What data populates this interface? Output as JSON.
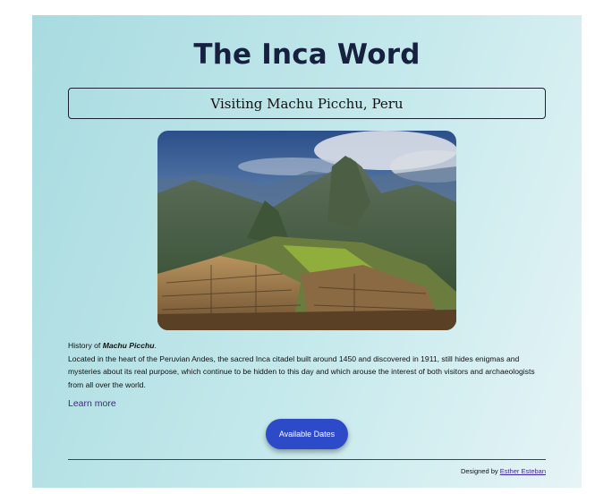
{
  "header": {
    "title": "The Inca Word"
  },
  "section": {
    "heading": "Visiting Machu Picchu, Peru"
  },
  "article": {
    "history_prefix": "History of ",
    "history_subject": "Machu Picchu",
    "history_suffix": ".",
    "body": "Located in the heart of the Peruvian Andes, the sacred Inca citadel built around 1450 and discovered in 1911, still hides enigmas and mysteries about its real purpose, which continue to be hidden to this day and which arouse the interest of both visitors and archaeologists from all over the world.",
    "learn_more": "Learn more"
  },
  "actions": {
    "dates_button": "Available Dates"
  },
  "footer": {
    "designed_by": "Designed by ",
    "author": "Esther Esteban"
  },
  "colors": {
    "button": "#2d4bc9",
    "title": "#16213f",
    "link": "#3d2a7a"
  }
}
